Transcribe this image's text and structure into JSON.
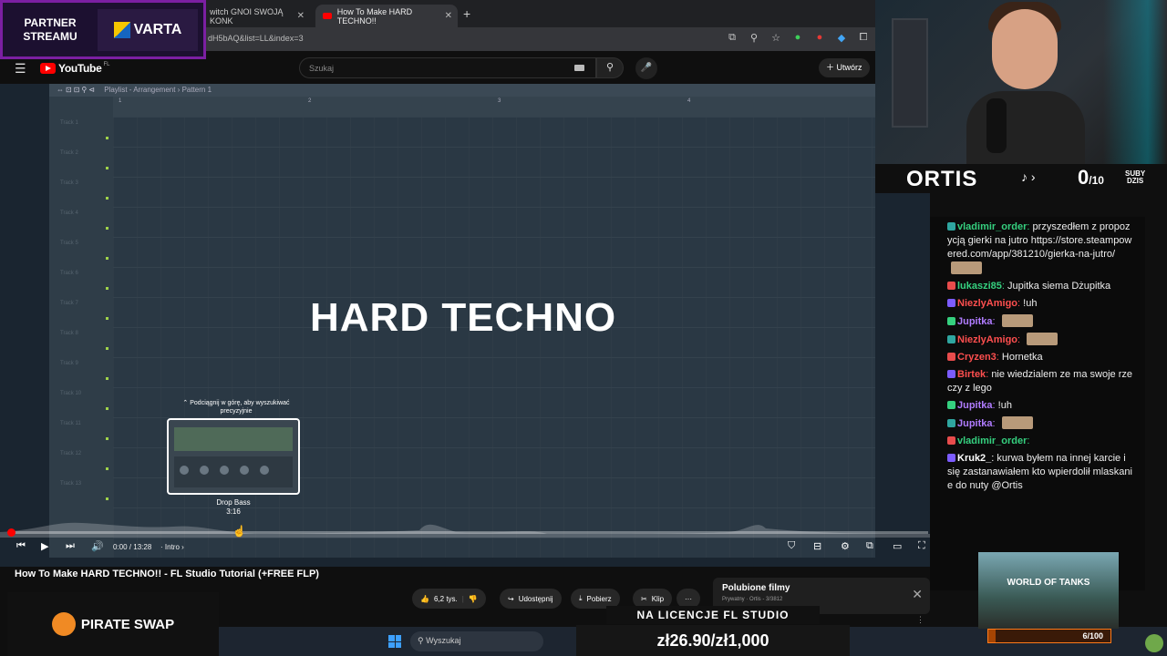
{
  "browser": {
    "tab_inactive": "witch GNOI SWOJĄ KONK",
    "tab_active": "How To Make HARD TECHNO!!",
    "url": "dH5bAQ&list=LL&index=3"
  },
  "partner": {
    "line1": "PARTNER",
    "line2": "STREAMU",
    "brand": "VARTA"
  },
  "youtube": {
    "logo": "YouTube",
    "country": "FL",
    "search_placeholder": "Szukaj",
    "create_label": "Utwórz"
  },
  "fl_studio": {
    "breadcrumb": "Playlist - Arrangement › Pattern 1",
    "bars": [
      "1",
      "2",
      "3",
      "4"
    ],
    "tracks": [
      "Track 1",
      "Track 2",
      "Track 3",
      "Track 4",
      "Track 5",
      "Track 6",
      "Track 7",
      "Track 8",
      "Track 9",
      "Track 10",
      "Track 11",
      "Track 12",
      "Track 13"
    ]
  },
  "video": {
    "overlay_title": "HARD TECHNO",
    "seek_hint": "Podciągnij w górę, aby wyszukiwać precyzyjnie",
    "preview_chapter": "Drop Bass",
    "preview_time": "3:16",
    "current_time": "0:00",
    "duration": "13:28",
    "chapter": "Intro",
    "progress": 0.0,
    "title": "How To Make HARD TECHNO!! - FL Studio Tutorial (+FREE FLP)"
  },
  "actions": {
    "likes": "6,2 tys.",
    "share": "Udostępnij",
    "download": "Pobierz",
    "clip": "Klip",
    "more": "···"
  },
  "liked_panel": {
    "title": "Polubione filmy",
    "subtitle": "Prywatny · Ortis - 3/3812"
  },
  "sponsors": {
    "pirate": "PIRATE SWAP",
    "license_banner": "NA LICENCJE FL STUDIO",
    "price": "zł26.90/zł1,000"
  },
  "taskbar": {
    "search": "Wyszukaj"
  },
  "stream": {
    "name": "ORTIS",
    "subs_count": "0",
    "subs_goal": "/10",
    "subs_label_1": "SUBY",
    "subs_label_2": "DZIS"
  },
  "chat": [
    {
      "user": "vladimir_order",
      "color": "#35d07f",
      "text": "przyszedłem z propozycją gierki na jutro https://store.steampowered.com/app/381210/gierka-na-jutro/",
      "emote": "after"
    },
    {
      "user": "lukaszi85",
      "color": "#35d07f",
      "text": "Jupitka siema Dżupitka"
    },
    {
      "user": "NiezlyAmigo",
      "color": "#ff4f4f",
      "text": "!uh"
    },
    {
      "user": "Jupitka",
      "color": "#b07cff",
      "text": "",
      "emote": "after"
    },
    {
      "user": "NiezlyAmigo",
      "color": "#ff4f4f",
      "text": "",
      "emote": "after"
    },
    {
      "user": "Cryzen3",
      "color": "#ff4f4f",
      "text": "Hornetka"
    },
    {
      "user": "Birtek",
      "color": "#ff4f4f",
      "text": "nie wiedzialem ze ma swoje rzeczy z lego"
    },
    {
      "user": "Jupitka",
      "color": "#b07cff",
      "text": "!uh"
    },
    {
      "user": "Jupitka",
      "color": "#b07cff",
      "text": "",
      "emote": "after"
    },
    {
      "user": "vladimir_order",
      "color": "#35d07f",
      "text": ""
    },
    {
      "user": "Kruk2_",
      "color": "#ffffff",
      "text": "kurwa byłem na innej karcie i się zastanawiałem kto wpierdolił mlaskanie do nuty @Ortis"
    }
  ],
  "wot_ad": {
    "title": "WORLD OF TANKS",
    "progress_label": "6/100",
    "progress": 0.06
  },
  "colors": {
    "accent": "#ff0000",
    "partner_border": "#7b1fa2",
    "wot_orange": "#ff6a00"
  }
}
